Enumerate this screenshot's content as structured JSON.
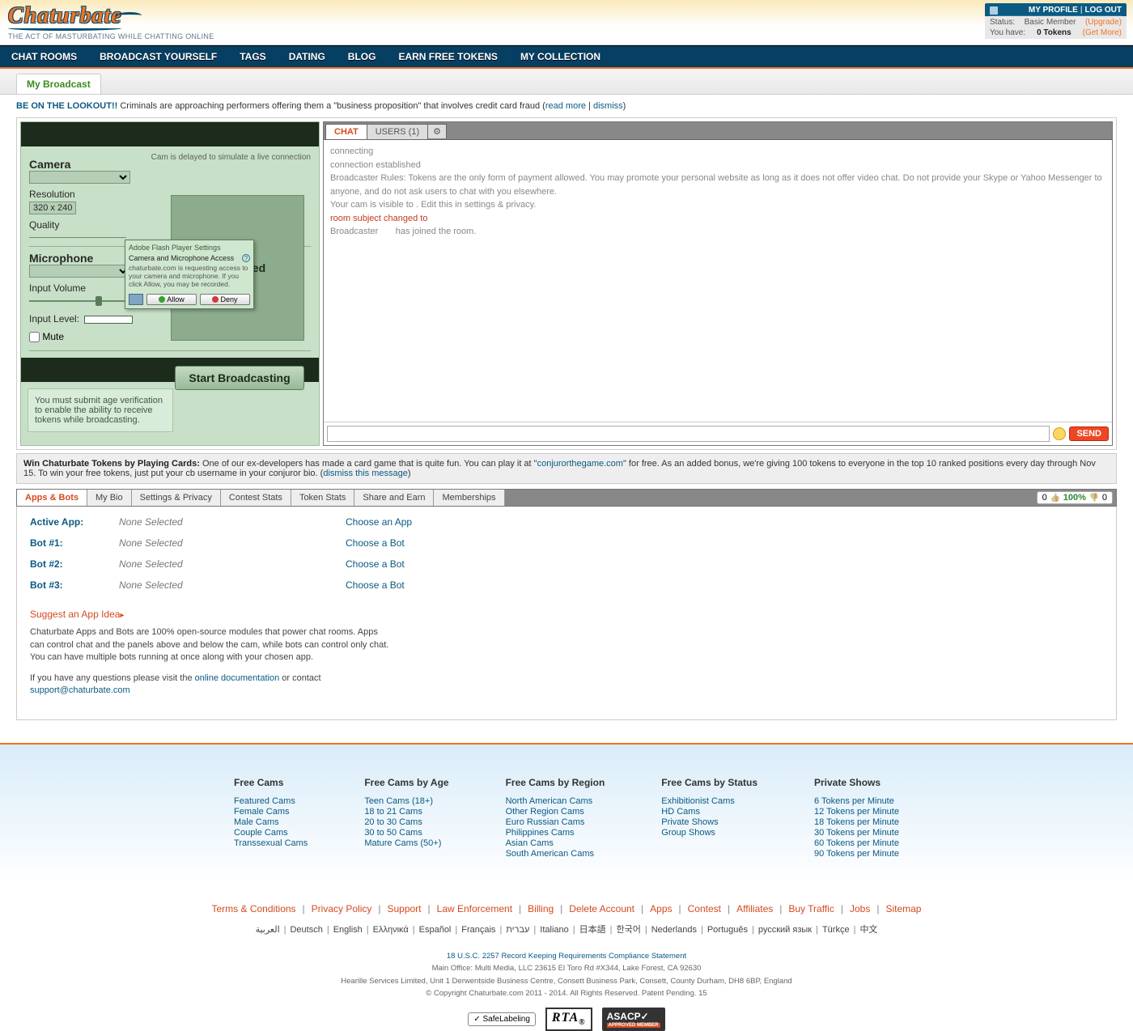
{
  "header": {
    "logo_text": "Chaturbate",
    "tagline": "THE ACT OF MASTURBATING WHILE CHATTING ONLINE",
    "my_profile": "MY PROFILE",
    "log_out": "LOG OUT",
    "status_label": "Status:",
    "status_value": "Basic Member",
    "upgrade": "(Upgrade)",
    "tokens_label": "You have:",
    "tokens_value": "0 Tokens",
    "get_more": "(Get More)"
  },
  "nav": [
    "CHAT ROOMS",
    "BROADCAST YOURSELF",
    "TAGS",
    "DATING",
    "BLOG",
    "EARN FREE TOKENS",
    "MY COLLECTION"
  ],
  "subtab": "My Broadcast",
  "alert": {
    "lead": "BE ON THE LOOKOUT!!",
    "text": "Criminals are approaching performers offering them a \"business proposition\" that involves credit card fraud",
    "read_more": "read more",
    "dismiss": "dismiss"
  },
  "cam": {
    "camera_h": "Camera",
    "delay_note": "Cam is delayed to simulate a live connection",
    "res_label": "Resolution",
    "res_value": "320 x 240",
    "quality_label": "Quality",
    "mic_h": "Microphone",
    "vol_label": "Input Volume",
    "level_label": "Input Level:",
    "mute_label": "Mute",
    "no_cam": "a Selected",
    "start_btn": "Start Broadcasting",
    "age_msg": "You must submit age verification to enable the ability to receive tokens while broadcasting."
  },
  "flash": {
    "title": "Adobe Flash Player Settings",
    "head": "Camera and Microphone Access",
    "body": "chaturbate.com is requesting access to your camera and microphone. If you click Allow, you may be recorded.",
    "allow": "Allow",
    "deny": "Deny"
  },
  "chat": {
    "tabs": {
      "chat": "CHAT",
      "users": "USERS (1)"
    },
    "lines": {
      "l1": "connecting",
      "l2": "connection established",
      "l3": "Broadcaster Rules: Tokens are the only form of payment allowed. You may promote your personal website as long as it does not offer video chat. Do not provide your Skype or Yahoo Messenger to anyone, and do not ask users to chat with you elsewhere.",
      "l4": "Your cam is visible to . Edit this in settings & privacy.",
      "l5": "room subject changed to",
      "l6a": "Broadcaster",
      "l6b": "has joined the room."
    },
    "send": "SEND"
  },
  "promo": {
    "lead": "Win Chaturbate Tokens by Playing Cards:",
    "p1": "One of our ex-developers has made a card game that is quite fun. You can play it at \"",
    "link": "conjurorthegame.com",
    "p2": "\" for free. As an added bonus, we're giving 100 tokens to everyone in the top 10 ranked positions every day through Nov 15. To win your free tokens, just put your cb username in your conjuror bio.",
    "dismiss": "dismiss this message"
  },
  "lowertabs": [
    "Apps & Bots",
    "My Bio",
    "Settings & Privacy",
    "Contest Stats",
    "Token Stats",
    "Share and Earn",
    "Memberships"
  ],
  "votes": {
    "up": "0",
    "pct": "100%",
    "down": "0"
  },
  "apps": {
    "rows": [
      {
        "k": "Active App:",
        "v": "None Selected",
        "a": "Choose an App"
      },
      {
        "k": "Bot #1:",
        "v": "None Selected",
        "a": "Choose a Bot"
      },
      {
        "k": "Bot #2:",
        "v": "None Selected",
        "a": "Choose a Bot"
      },
      {
        "k": "Bot #3:",
        "v": "None Selected",
        "a": "Choose a Bot"
      }
    ],
    "suggest": "Suggest an App Idea",
    "p1": "Chaturbate Apps and Bots are 100% open-source modules that power chat rooms. Apps can control chat and the panels above and below the cam, while bots can control only chat. You can have multiple bots running at once along with your chosen app.",
    "p2a": "If you have any questions please visit the ",
    "doc_link": "online documentation",
    "p2b": " or contact ",
    "email": "support@chaturbate.com"
  },
  "footer": {
    "cols": [
      {
        "h": "Free Cams",
        "items": [
          "Featured Cams",
          "Female Cams",
          "Male Cams",
          "Couple Cams",
          "Transsexual Cams"
        ]
      },
      {
        "h": "Free Cams by Age",
        "items": [
          "Teen Cams (18+)",
          "18 to 21 Cams",
          "20 to 30 Cams",
          "30 to 50 Cams",
          "Mature Cams (50+)"
        ]
      },
      {
        "h": "Free Cams by Region",
        "items": [
          "North American Cams",
          "Other Region Cams",
          "Euro Russian Cams",
          "Philippines Cams",
          "Asian Cams",
          "South American Cams"
        ]
      },
      {
        "h": "Free Cams by Status",
        "items": [
          "Exhibitionist Cams",
          "HD Cams",
          "Private Shows",
          "Group Shows"
        ]
      },
      {
        "h": "Private Shows",
        "items": [
          "6 Tokens per Minute",
          "12 Tokens per Minute",
          "18 Tokens per Minute",
          "30 Tokens per Minute",
          "60 Tokens per Minute",
          "90 Tokens per Minute"
        ]
      }
    ],
    "legal": [
      "Terms & Conditions",
      "Privacy Policy",
      "Support",
      "Law Enforcement",
      "Billing",
      "Delete Account",
      "Apps",
      "Contest",
      "Affiliates",
      "Buy Traffic",
      "Jobs",
      "Sitemap"
    ],
    "langs": [
      "العربية",
      "Deutsch",
      "English",
      "Ελληνικά",
      "Español",
      "Français",
      "עברית",
      "Italiano",
      "日本語",
      "한국어",
      "Nederlands",
      "Português",
      "русский язык",
      "Türkçe",
      "中文"
    ],
    "tiny1": "18 U.S.C. 2257 Record Keeping Requirements Compliance Statement",
    "tiny2": "Main Office: Multi Media, LLC 23615 El Toro Rd #X344, Lake Forest, CA 92630",
    "tiny3": "Hearille Services Limited, Unit 1 Derwentside Business Centre, Consett Business Park, Consett, County Durham, DH8 6BP, England",
    "tiny4": "© Copyright Chaturbate.com 2011 - 2014. All Rights Reserved. Patent Pending. 15",
    "safe": "SafeLabeling",
    "rta": "RTA",
    "asacp": "ASACP"
  }
}
